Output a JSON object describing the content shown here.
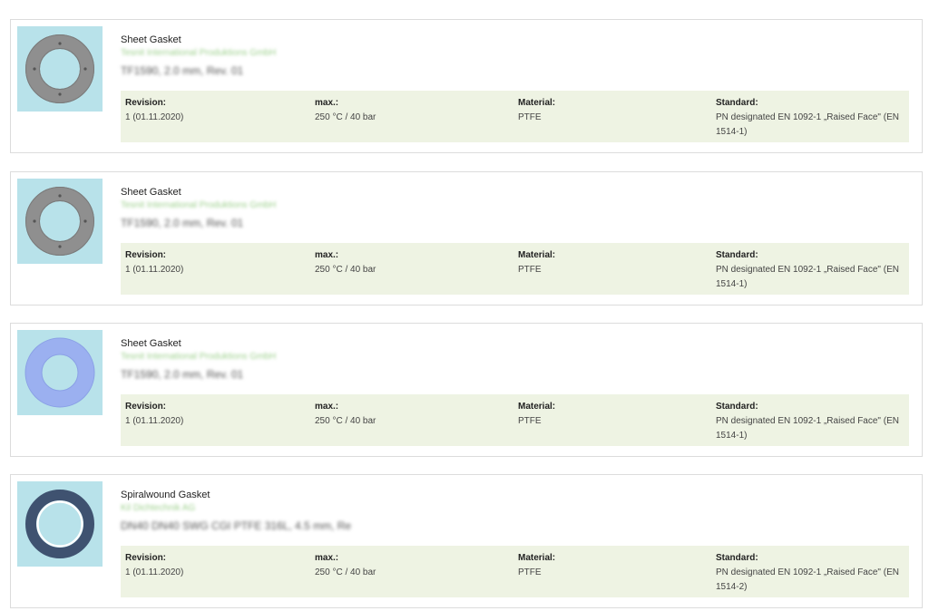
{
  "labels": {
    "revision": "Revision:",
    "max": "max.:",
    "material": "Material:",
    "standard": "Standard:"
  },
  "colors": {
    "thumb_bg": "#b8e2ea",
    "spec_bg": "#eef3e3",
    "maker_text": "#9fd18f"
  },
  "items": [
    {
      "title": "Sheet Gasket",
      "maker": "Tesnit International Produktions GmbH",
      "part": "TF1590, 2.0 mm, Rev. 01",
      "revision": "1 (01.11.2020)",
      "max": "250 °C / 40 bar",
      "material": "PTFE",
      "standard": "PN designated EN 1092-1 „Raised Face\" (EN 1514-1)",
      "thumb_icon": "grey-sheet-gasket-icon"
    },
    {
      "title": "Sheet Gasket",
      "maker": "Tesnit International Produktions GmbH",
      "part": "TF1590, 2.0 mm, Rev. 01",
      "revision": "1 (01.11.2020)",
      "max": "250 °C / 40 bar",
      "material": "PTFE",
      "standard": "PN designated EN 1092-1 „Raised Face\" (EN 1514-1)",
      "thumb_icon": "grey-sheet-gasket-icon"
    },
    {
      "title": "Sheet Gasket",
      "maker": "Tesnit International Produktions GmbH",
      "part": "TF1590, 2.0 mm, Rev. 01",
      "revision": "1 (01.11.2020)",
      "max": "250 °C / 40 bar",
      "material": "PTFE",
      "standard": "PN designated EN 1092-1 „Raised Face\" (EN 1514-1)",
      "thumb_icon": "blue-sheet-gasket-icon"
    },
    {
      "title": "Spiralwound Gasket",
      "maker": "Kil Dichtechnik AG",
      "part": "DN40 DN40 SWG CGI PTFE 316L, 4.5 mm, Re",
      "revision": "1 (01.11.2020)",
      "max": "250 °C / 40 bar",
      "material": "PTFE",
      "standard": "PN designated EN 1092-1 „Raised Face\" (EN 1514-2)",
      "thumb_icon": "spiralwound-gasket-icon"
    }
  ]
}
